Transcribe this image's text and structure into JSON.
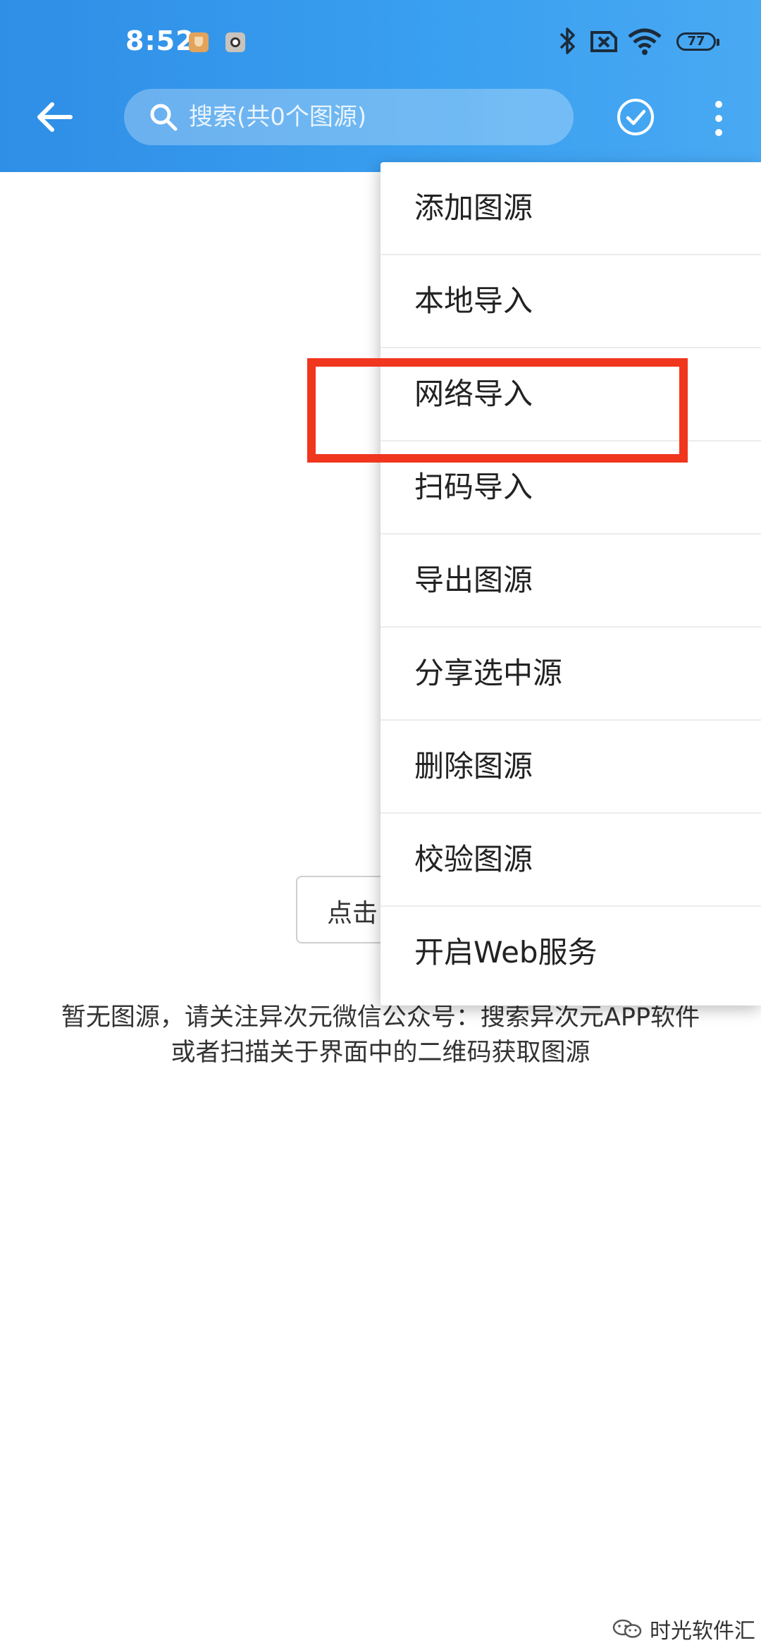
{
  "status_bar": {
    "time": "8:52",
    "battery": "77"
  },
  "toolbar": {
    "search_placeholder": "搜索(共0个图源)"
  },
  "menu": {
    "items": [
      {
        "label": "添加图源"
      },
      {
        "label": "本地导入"
      },
      {
        "label": "网络导入"
      },
      {
        "label": "扫码导入"
      },
      {
        "label": "导出图源"
      },
      {
        "label": "分享选中源"
      },
      {
        "label": "删除图源"
      },
      {
        "label": "校验图源"
      },
      {
        "label": "开启Web服务"
      }
    ],
    "highlighted_index": 2
  },
  "empty_state": {
    "button_label": "点击",
    "message_line1": "暂无图源，请关注异次元微信公众号：搜索异次元APP软件",
    "message_line2": "或者扫描关于界面中的二维码获取图源"
  },
  "watermark": {
    "text": "时光软件汇"
  },
  "colors": {
    "header": "#3a9cee",
    "highlight": "#f0361d"
  }
}
